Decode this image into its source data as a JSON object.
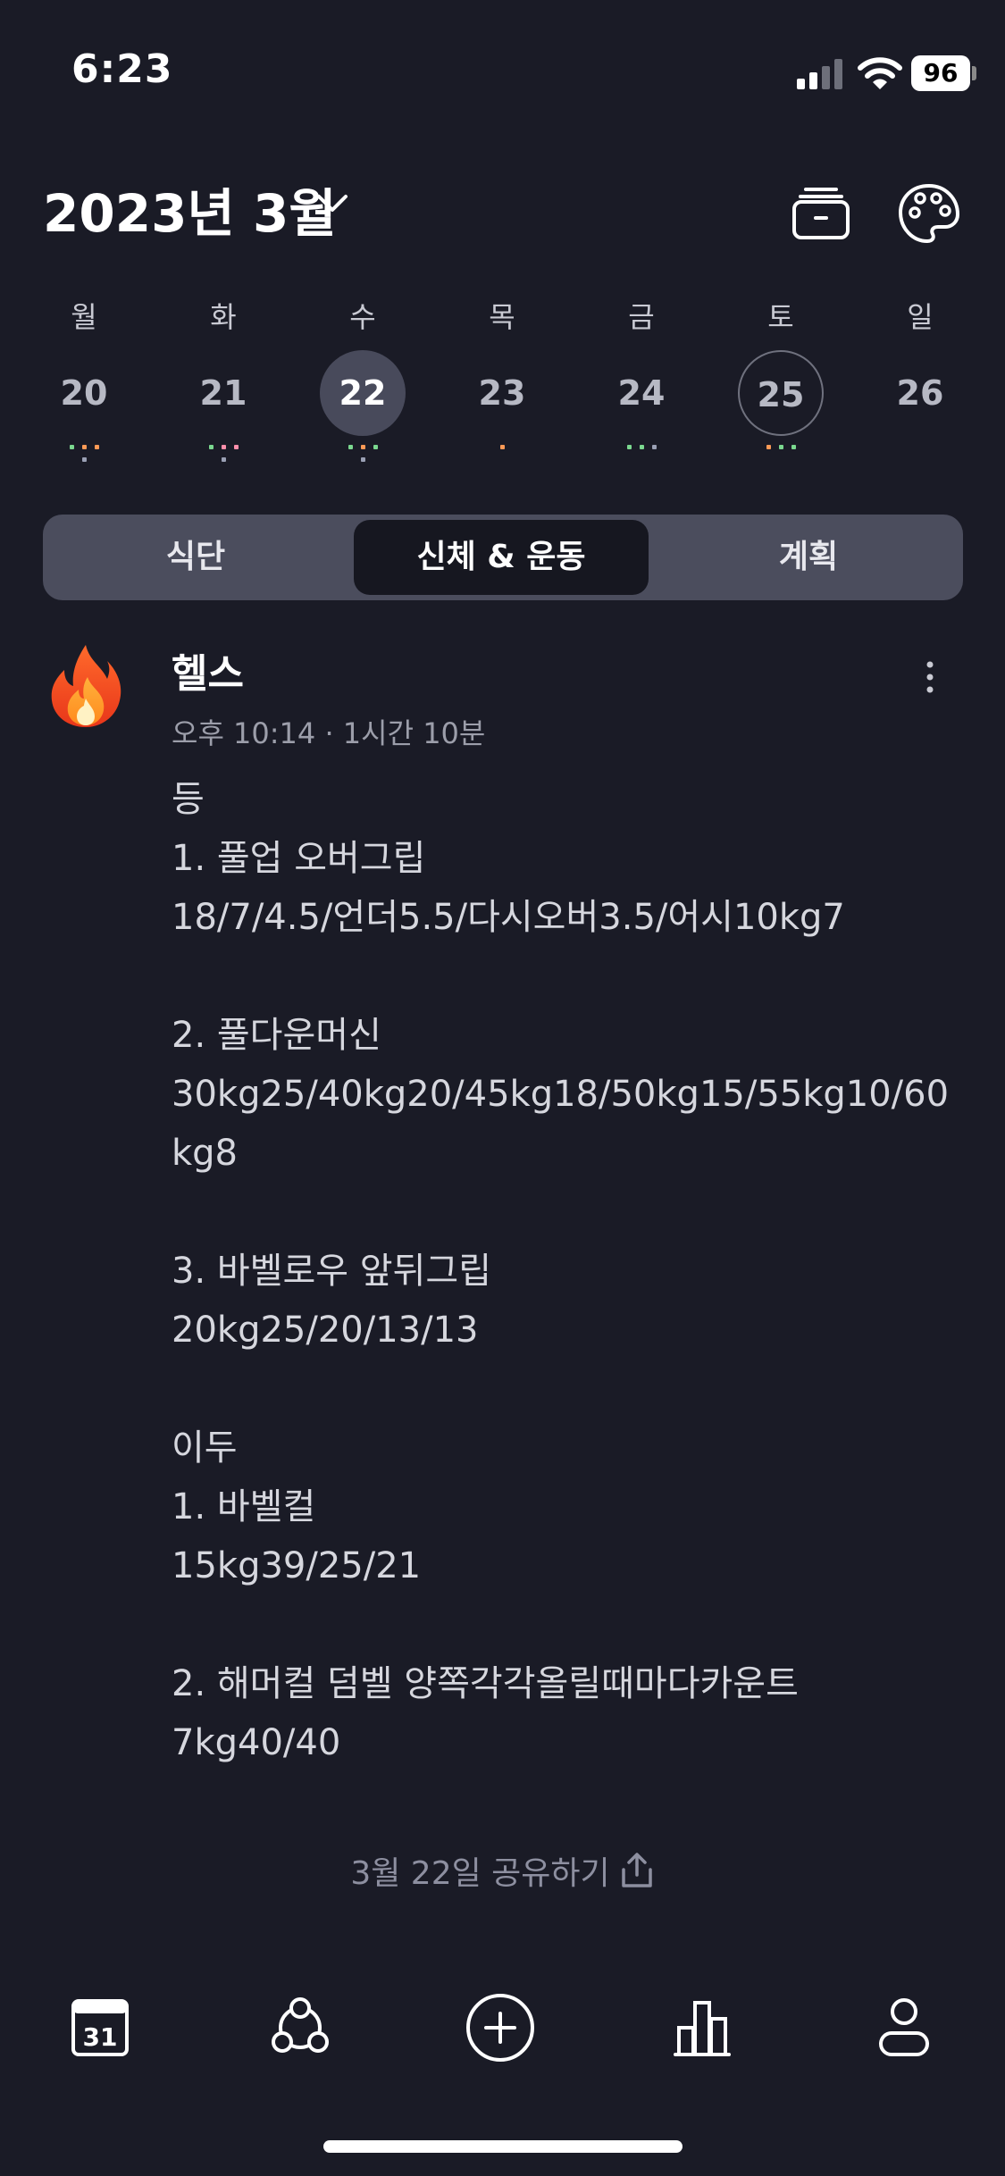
{
  "status_bar": {
    "time": "6:23",
    "battery": "96"
  },
  "header": {
    "month_title": "2023년 3월"
  },
  "week": {
    "days": [
      {
        "dow": "월",
        "date": "20",
        "dots": [
          "#7bd88f",
          "#ff9a56",
          "#ff9a56",
          "#9aa0b4"
        ]
      },
      {
        "dow": "화",
        "date": "21",
        "dots": [
          "#7bd88f",
          "#ff8fab",
          "#ff8fab",
          "#9aa0b4"
        ]
      },
      {
        "dow": "수",
        "date": "22",
        "selected": true,
        "dots": [
          "#7bd88f",
          "#ff9a56",
          "#7bd88f",
          "#9aa0b4"
        ]
      },
      {
        "dow": "목",
        "date": "23",
        "dots": [
          "#ff9a56"
        ]
      },
      {
        "dow": "금",
        "date": "24",
        "dots": [
          "#7bd88f",
          "#7bd88f",
          "#9aa0b4"
        ]
      },
      {
        "dow": "토",
        "date": "25",
        "today": true,
        "dots": [
          "#ff9a56",
          "#7bd88f",
          "#7bd88f"
        ]
      },
      {
        "dow": "일",
        "date": "26",
        "dots": []
      }
    ]
  },
  "tabs": {
    "diet": "식단",
    "body_exercise": "신체 & 운동",
    "plan": "계획",
    "active": "body_exercise"
  },
  "entry": {
    "icon": "fire-icon",
    "title": "헬스",
    "meta": "오후 10:14 · 1시간 10분",
    "body": "등\n1. 풀업 오버그립\n18/7/4.5/언더5.5/다시오버3.5/어시10kg7\n\n2. 풀다운머신\n30kg25/40kg20/45kg18/50kg15/55kg10/60kg8\n\n3. 바벨로우 앞뒤그립\n20kg25/20/13/13\n\n이두\n1. 바벨컬\n15kg39/25/21\n\n2. 해머컬 덤벨 양쪽각각올릴때마다카운트\n7kg40/40"
  },
  "share": {
    "label": "3월 22일 공유하기"
  },
  "tabbar": {
    "calendar_day": "31"
  }
}
